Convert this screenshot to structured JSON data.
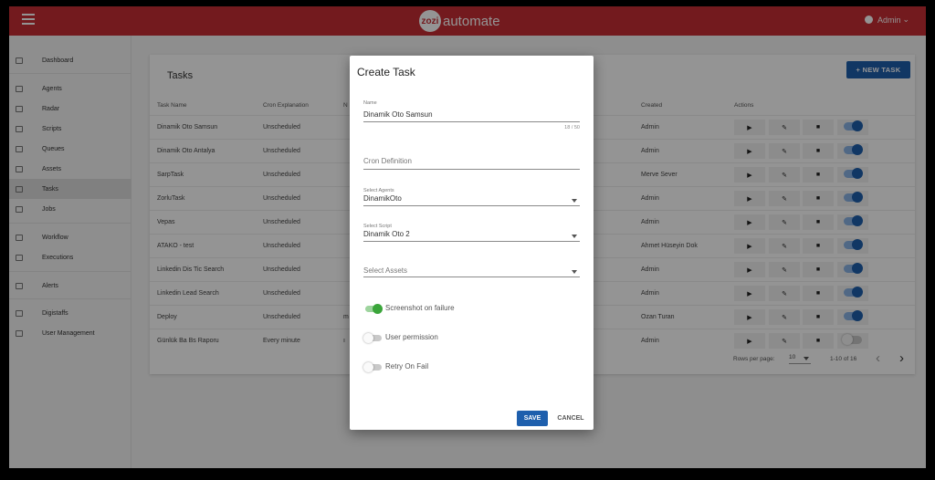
{
  "header": {
    "logo_badge": "zozi",
    "logo_text": "automate",
    "user": "Admin",
    "user_caret": "⌄",
    "menu_icon": "hamburger-icon"
  },
  "sidebar": {
    "items": [
      {
        "label": "Dashboard",
        "icon": "dashboard-icon"
      },
      {
        "label": "Agents",
        "icon": "laptop-icon"
      },
      {
        "label": "Radar",
        "icon": "radar-icon"
      },
      {
        "label": "Scripts",
        "icon": "script-icon"
      },
      {
        "label": "Queues",
        "icon": "cloud-icon"
      },
      {
        "label": "Assets",
        "icon": "asset-icon"
      },
      {
        "label": "Tasks",
        "icon": "task-icon",
        "active": true
      },
      {
        "label": "Jobs",
        "icon": "jobs-icon"
      },
      {
        "label": "Workflow",
        "icon": "workflow-icon"
      },
      {
        "label": "Executions",
        "icon": "executions-icon"
      },
      {
        "label": "Alerts",
        "icon": "bell-icon"
      },
      {
        "label": "Digistaffs",
        "icon": "robot-icon"
      },
      {
        "label": "User Management",
        "icon": "users-icon"
      }
    ]
  },
  "tasks": {
    "title": "Tasks",
    "new_button": "+ NEW TASK",
    "columns": {
      "name": "Task Name",
      "cron": "Cron Explanation",
      "next": "N",
      "created": "Created",
      "actions": "Actions"
    },
    "action_icons": {
      "run": "▶",
      "edit": "✎",
      "delete": "■"
    },
    "rows": [
      {
        "name": "Dinamik Oto Samsun",
        "cron": "Unscheduled",
        "next": "",
        "created": "Admin",
        "enabled": true
      },
      {
        "name": "Dinamik Oto Antalya",
        "cron": "Unscheduled",
        "next": "",
        "created": "Admin",
        "enabled": true
      },
      {
        "name": "SarpTask",
        "cron": "Unscheduled",
        "next": "",
        "created": "Merve Sever",
        "enabled": true
      },
      {
        "name": "ZorluTask",
        "cron": "Unscheduled",
        "next": "",
        "created": "Admin",
        "enabled": true
      },
      {
        "name": "Vepas",
        "cron": "Unscheduled",
        "next": "",
        "created": "Admin",
        "enabled": true
      },
      {
        "name": "ATAKO - test",
        "cron": "Unscheduled",
        "next": "",
        "created": "Ahmet Hüseyin Dok",
        "enabled": true
      },
      {
        "name": "Linkedin Dis Tic Search",
        "cron": "Unscheduled",
        "next": "",
        "created": "Admin",
        "enabled": true
      },
      {
        "name": "Linkedin Lead Search",
        "cron": "Unscheduled",
        "next": "",
        "created": "Admin",
        "enabled": true
      },
      {
        "name": "Deploy",
        "cron": "Unscheduled",
        "next": "m",
        "created": "Ozan Turan",
        "enabled": true
      },
      {
        "name": "Günlük Ba Bs Raporu",
        "cron": "Every minute",
        "next": "ı",
        "created": "Admin",
        "enabled": false
      }
    ],
    "pagination": {
      "rows_label": "Rows per page:",
      "rows_value": "10",
      "range": "1-10 of 16",
      "prev": "‹",
      "next": "›"
    }
  },
  "dialog": {
    "title": "Create Task",
    "name_label": "Name",
    "name_value": "Dinamik Oto Samsun",
    "name_counter": "18 / 50",
    "cron_placeholder": "Cron Definition",
    "agents_label": "Select Agents",
    "agents_value": "DinamikOto",
    "script_label": "Select Script",
    "script_value": "Dinamik Oto 2",
    "assets_placeholder": "Select Assets",
    "toggles": [
      {
        "label": "Screenshot on failure",
        "on": true
      },
      {
        "label": "User permission",
        "on": false
      },
      {
        "label": "Retry On Fail",
        "on": false
      }
    ],
    "save": "SAVE",
    "cancel": "CANCEL"
  }
}
